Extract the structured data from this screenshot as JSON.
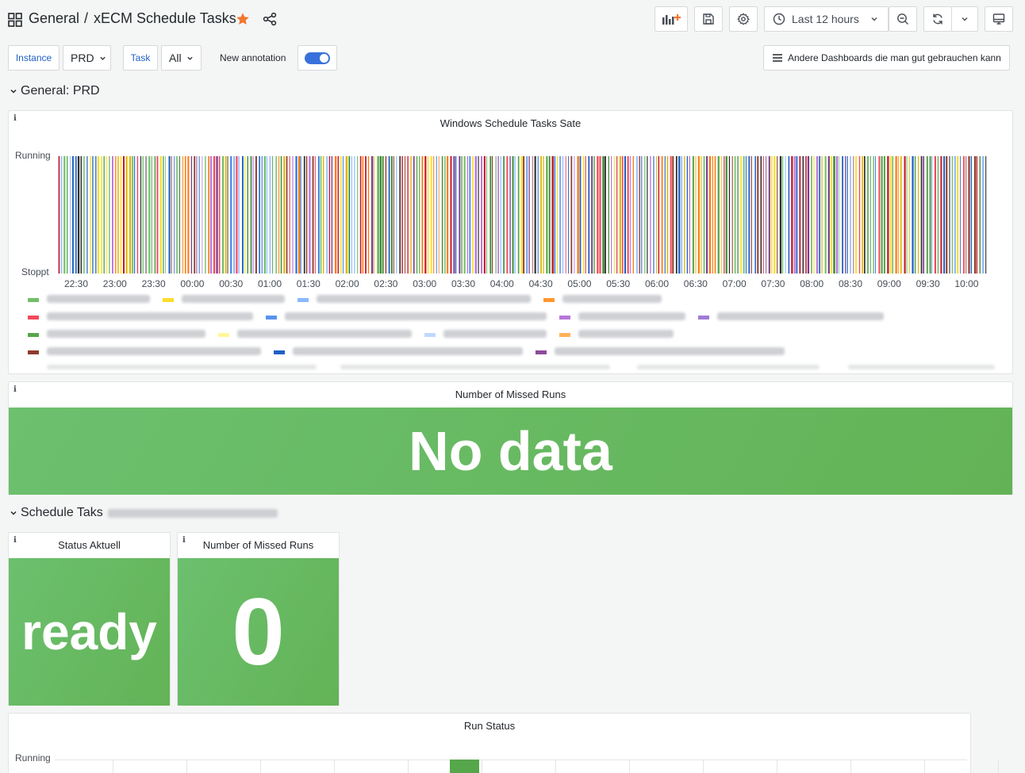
{
  "header": {
    "breadcrumb_folder": "General",
    "breadcrumb_sep": "/",
    "dashboard_title": "xECM Schedule Tasks",
    "time_range": "Last 12 hours"
  },
  "variables": {
    "instance_label": "Instance",
    "instance_value": "PRD",
    "task_label": "Task",
    "task_value": "All",
    "annotation_label": "New annotation",
    "annotation_enabled": true,
    "dashboards_link": "Andere Dashboards die man gut gebrauchen kann"
  },
  "rows": {
    "general_title": "General: PRD",
    "schedule_title": "Schedule Taks"
  },
  "panels": {
    "state_timeline": {
      "title": "Windows Schedule Tasks Sate",
      "y_top": "Running",
      "y_bottom": "Stoppt"
    },
    "missed_runs": {
      "title": "Number of Missed Runs",
      "value": "No data"
    },
    "status_aktuell": {
      "title": "Status Aktuell",
      "value": "ready"
    },
    "missed_runs_single": {
      "title": "Number of Missed Runs",
      "value": "0"
    },
    "run_status": {
      "title": "Run Status",
      "y_top": "Running"
    }
  },
  "chart_data": {
    "type": "bar",
    "title": "Windows Schedule Tasks Sate",
    "x_ticks": [
      "22:30",
      "23:00",
      "23:30",
      "00:00",
      "00:30",
      "01:00",
      "01:30",
      "02:00",
      "02:30",
      "03:00",
      "03:30",
      "04:00",
      "04:30",
      "05:00",
      "05:30",
      "06:00",
      "06:30",
      "07:00",
      "07:30",
      "08:00",
      "08:30",
      "09:00",
      "09:30",
      "10:00"
    ],
    "y_categories": [
      "Stoppt",
      "Running"
    ],
    "legend_colors": [
      "#73bf69",
      "#fade2a",
      "#8ab8ff",
      "#ff9830",
      "#f2495c",
      "#5794f2",
      "#b877d9",
      "#a07bd6",
      "#56a64b",
      "#fff899",
      "#c0d8ff",
      "#ffb357",
      "#8f3b2b",
      "#1f60c4",
      "#8e4a9b"
    ],
    "bar_colors": [
      "#37872d",
      "#c4162a",
      "#1f60c4",
      "#fade2a",
      "#8f3b2b",
      "#3274d9",
      "#ff780a",
      "#8ab8ff",
      "#73bf69",
      "#b877d9",
      "#f2495c",
      "#56a64b",
      "#e0b400",
      "#7a3b8a",
      "#2e2e2e"
    ],
    "bar_count": 330
  },
  "icons": {
    "apps": "apps-grid-icon",
    "star": "star-icon",
    "share": "share-icon",
    "add_panel": "add-panel-icon",
    "save": "save-icon",
    "settings": "gear-icon",
    "clock": "clock-icon",
    "zoom_out": "zoom-out-icon",
    "refresh": "refresh-icon",
    "tv": "tv-mode-icon"
  },
  "colors": {
    "accent": "#1f60c4",
    "star": "#f2762e",
    "stat_green": "#6cc06e"
  }
}
